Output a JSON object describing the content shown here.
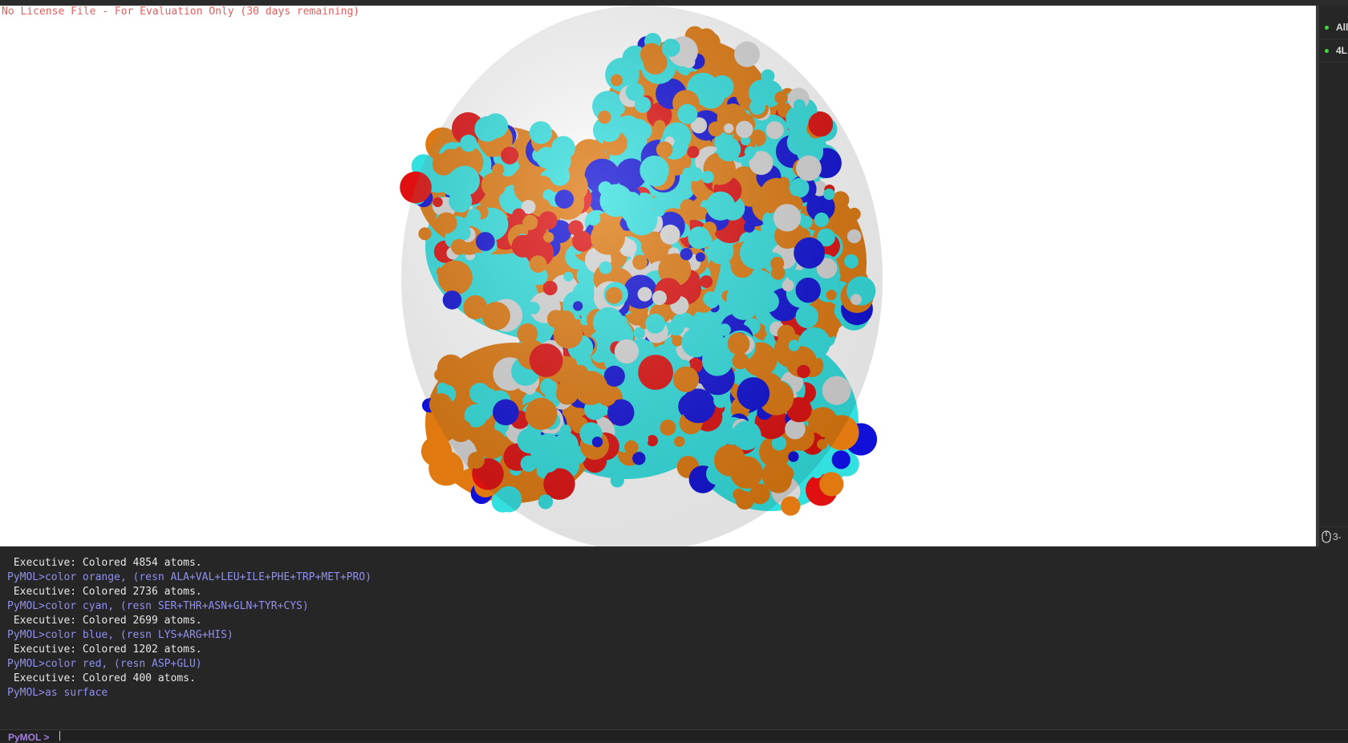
{
  "viewer": {
    "license_notice": "No License File - For Evaluation Only (30 days remaining)",
    "molecule_colors": {
      "background": "#ffffff",
      "hydrophobic": "#e07a10",
      "polar": "#33e0e0",
      "basic": "#1010d8",
      "acidic": "#e01010",
      "other": "#d8d8d8"
    }
  },
  "object_panel": {
    "items": [
      {
        "label": "All"
      },
      {
        "label": "4L"
      }
    ],
    "mouse_mode": "3-"
  },
  "console": {
    "lines": [
      {
        "kind": "out",
        "text": " Executive: Colored 4854 atoms."
      },
      {
        "kind": "cmd",
        "text": "PyMOL>color orange, (resn ALA+VAL+LEU+ILE+PHE+TRP+MET+PRO)"
      },
      {
        "kind": "out",
        "text": " Executive: Colored 2736 atoms."
      },
      {
        "kind": "cmd",
        "text": "PyMOL>color cyan, (resn SER+THR+ASN+GLN+TYR+CYS)"
      },
      {
        "kind": "out",
        "text": " Executive: Colored 2699 atoms."
      },
      {
        "kind": "cmd",
        "text": "PyMOL>color blue, (resn LYS+ARG+HIS)"
      },
      {
        "kind": "out",
        "text": " Executive: Colored 1202 atoms."
      },
      {
        "kind": "cmd",
        "text": "PyMOL>color red, (resn ASP+GLU)"
      },
      {
        "kind": "out",
        "text": " Executive: Colored 400 atoms."
      },
      {
        "kind": "cmd",
        "text": "PyMOL>as surface"
      }
    ],
    "prompt": "PyMOL >",
    "input_value": ""
  }
}
